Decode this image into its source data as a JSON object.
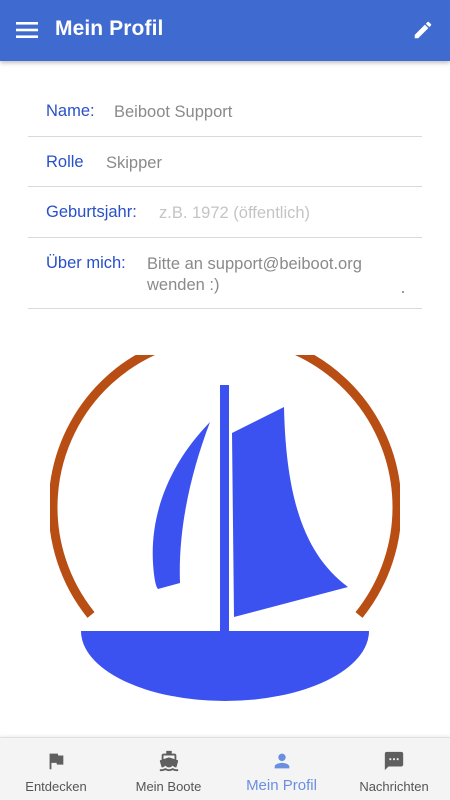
{
  "app_bar": {
    "title": "Mein Profil",
    "menu_icon": "menu-icon",
    "edit_icon": "pencil-icon",
    "color": "#3f6bd1"
  },
  "profile": {
    "name_label": "Name:",
    "name_value": "Beiboot Support",
    "rolle_label": "Rolle",
    "rolle_value": "Skipper",
    "geburtsjahr_label": "Geburtsjahr:",
    "geburtsjahr_placeholder": "z.B. 1972 (öffentlich)",
    "ueber_label": "Über mich:",
    "ueber_value": "Bitte an support@beiboot.org\nwenden :)"
  },
  "logo": {
    "ring_color": "#b84e14",
    "sail_color": "#3c52f0"
  },
  "bottom_nav": {
    "items": [
      {
        "label": "Entdecken",
        "icon": "flag-icon"
      },
      {
        "label": "Mein Boote",
        "icon": "boat-icon"
      },
      {
        "label": "Mein Profil",
        "icon": "person-icon",
        "active": true
      },
      {
        "label": "Nachrichten",
        "icon": "chat-icon"
      }
    ],
    "active_color": "#6a8fe0"
  }
}
